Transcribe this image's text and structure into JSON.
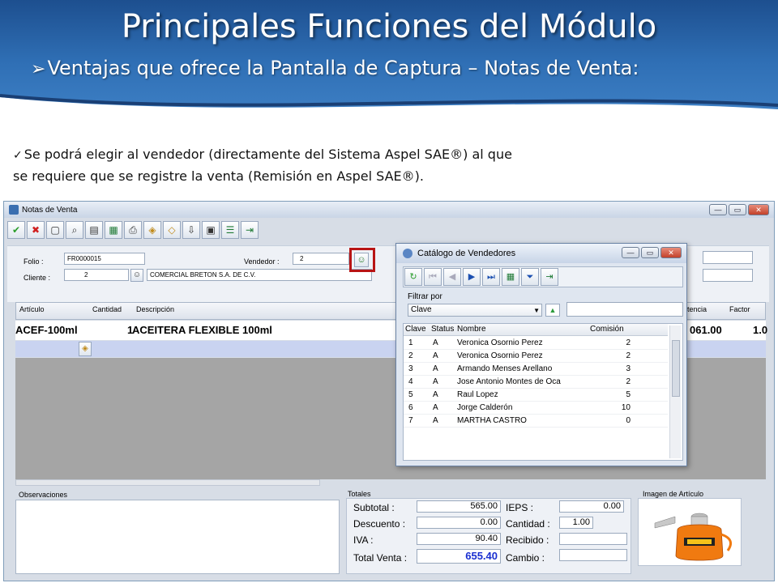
{
  "slide": {
    "title": "Principales Funciones del Módulo",
    "subtitle": "Ventajas que ofrece la Pantalla de Captura – Notas de Venta:",
    "bullet_line1": "Se podrá elegir al vendedor (directamente del Sistema Aspel SAE®) al que",
    "bullet_line2": "se requiere que se registre la venta (Remisión en Aspel SAE®)."
  },
  "window": {
    "title": "Notas de Venta",
    "toolbar_icons": [
      "check-icon",
      "delete-icon",
      "new-icon",
      "search-icon",
      "document-icon",
      "excel-icon",
      "print-icon",
      "box-icon",
      "box-open-icon",
      "import-icon",
      "calculator-icon",
      "list-icon",
      "exit-icon"
    ]
  },
  "form": {
    "folio_label": "Folio :",
    "folio_value": "FR0000015",
    "cliente_label": "Cliente :",
    "cliente_value": "2",
    "cliente_name": "COMERCIAL BRETON S.A. DE C.V.",
    "vendedor_label": "Vendedor :",
    "vendedor_value": "2"
  },
  "grid": {
    "headers": [
      "Artículo",
      "Cantidad",
      "Descripción",
      "tencia",
      "Factor"
    ],
    "row": {
      "articulo": "ACEF-100ml",
      "cantidad": "1",
      "descripcion": "ACEITERA FLEXIBLE 100ml",
      "existencia": "061.00",
      "factor": "1.0"
    }
  },
  "observaciones_label": "Observaciones",
  "totales": {
    "label": "Totales",
    "subtotal_label": "Subtotal :",
    "subtotal": "565.00",
    "descuento_label": "Descuento :",
    "descuento": "0.00",
    "iva_label": "IVA :",
    "iva": "90.40",
    "total_label": "Total Venta :",
    "total": "655.40",
    "ieps_label": "IEPS :",
    "ieps": "0.00",
    "cantidad_label": "Cantidad :",
    "cantidad": "1.00",
    "recibido_label": "Recibido :",
    "recibido": "",
    "cambio_label": "Cambio :",
    "cambio": ""
  },
  "imagen_label": "Imagen de Artículo",
  "catalogo": {
    "title": "Catálogo de Vendedores",
    "filtrar_label": "Filtrar por",
    "filter_selected": "Clave",
    "columns": [
      "Clave",
      "Status",
      "Nombre",
      "Comisión"
    ],
    "rows": [
      {
        "clave": "1",
        "status": "A",
        "nombre": "Veronica Osornio Perez",
        "comision": "2"
      },
      {
        "clave": "2",
        "status": "A",
        "nombre": "Veronica Osornio Perez",
        "comision": "2"
      },
      {
        "clave": "3",
        "status": "A",
        "nombre": "Armando Menses Arellano",
        "comision": "3"
      },
      {
        "clave": "4",
        "status": "A",
        "nombre": "Jose Antonio Montes de Oca",
        "comision": "2"
      },
      {
        "clave": "5",
        "status": "A",
        "nombre": "Raul Lopez",
        "comision": "5"
      },
      {
        "clave": "6",
        "status": "A",
        "nombre": "Jorge Calderón",
        "comision": "10"
      },
      {
        "clave": "7",
        "status": "A",
        "nombre": "MARTHA CASTRO",
        "comision": "0"
      }
    ]
  },
  "colors": {
    "header_blue": "#2f6fb5",
    "total_blue": "#1a2fd0",
    "highlight_red": "#b81414"
  }
}
